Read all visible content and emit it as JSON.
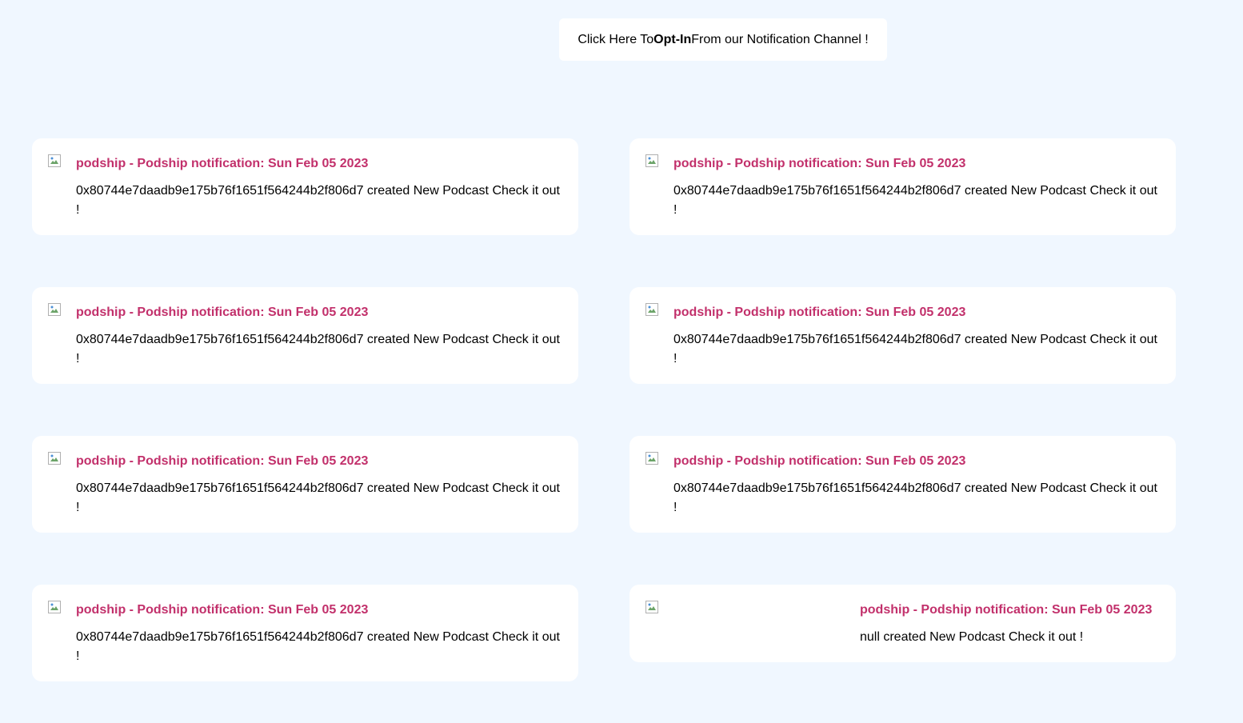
{
  "optin": {
    "prefix": "Click Here To ",
    "bold": "Opt-In",
    "suffix": " From our Notification Channel !"
  },
  "notifications": [
    {
      "title": "podship - Podship notification: Sun Feb 05 2023",
      "message": "0x80744e7daadb9e175b76f1651f564244b2f806d7 created New Podcast Check it out !",
      "icon": "broken-image-icon"
    },
    {
      "title": "podship - Podship notification: Sun Feb 05 2023",
      "message": "0x80744e7daadb9e175b76f1651f564244b2f806d7 created New Podcast Check it out !",
      "icon": "broken-image-icon"
    },
    {
      "title": "podship - Podship notification: Sun Feb 05 2023",
      "message": "0x80744e7daadb9e175b76f1651f564244b2f806d7 created New Podcast Check it out !",
      "icon": "broken-image-icon"
    },
    {
      "title": "podship - Podship notification: Sun Feb 05 2023",
      "message": "0x80744e7daadb9e175b76f1651f564244b2f806d7 created New Podcast Check it out !",
      "icon": "broken-image-icon"
    },
    {
      "title": "podship - Podship notification: Sun Feb 05 2023",
      "message": "0x80744e7daadb9e175b76f1651f564244b2f806d7 created New Podcast Check it out !",
      "icon": "broken-image-icon"
    },
    {
      "title": "podship - Podship notification: Sun Feb 05 2023",
      "message": "0x80744e7daadb9e175b76f1651f564244b2f806d7 created New Podcast Check it out !",
      "icon": "broken-image-icon"
    },
    {
      "title": "podship - Podship notification: Sun Feb 05 2023",
      "message": "0x80744e7daadb9e175b76f1651f564244b2f806d7 created New Podcast Check it out !",
      "icon": "broken-image-icon"
    },
    {
      "title": "podship - Podship notification: Sun Feb 05 2023",
      "message": "null created New Podcast Check it out !",
      "icon": "broken-image-icon"
    }
  ],
  "colors": {
    "background": "#f0f7ff",
    "card": "#ffffff",
    "title_accent": "#c2306b"
  }
}
